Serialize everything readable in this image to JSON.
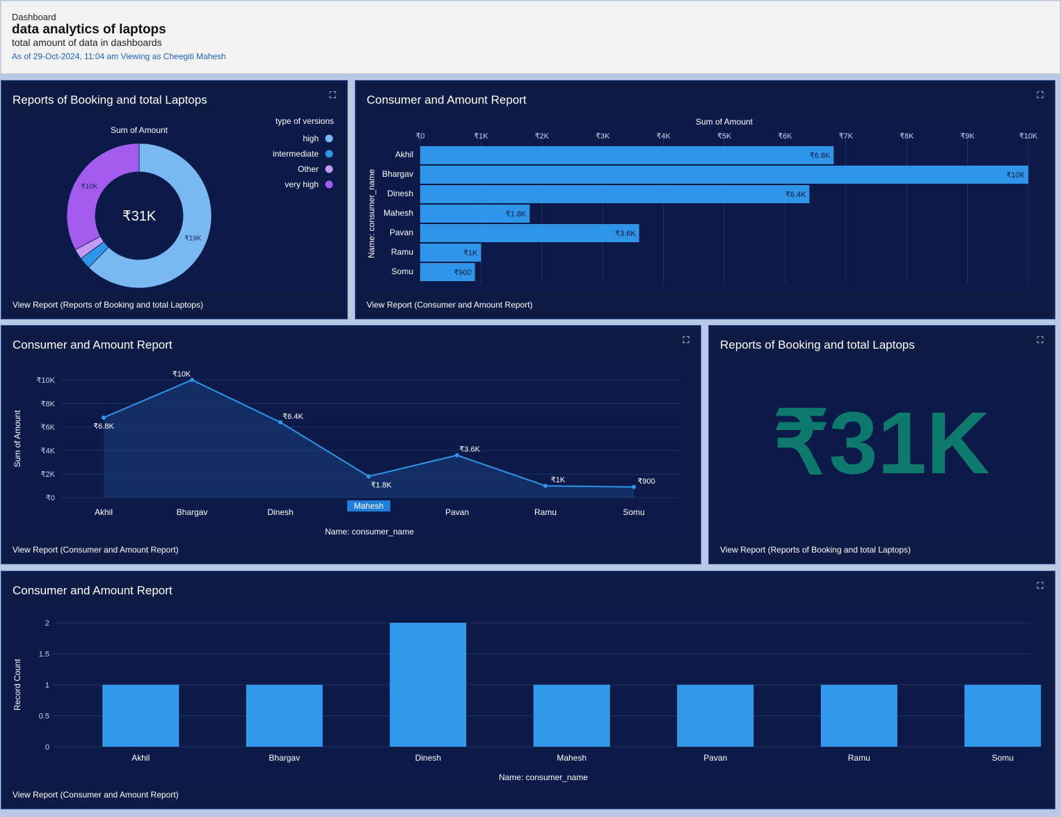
{
  "header": {
    "crumb": "Dashboard",
    "title": "data analytics of laptops",
    "subtitle": "total amount of data in dashboards",
    "meta": "As of 29-Oct-2024, 11:04 am Viewing as Cheegiti Mahesh"
  },
  "donut_card": {
    "title": "Reports of Booking and total Laptops",
    "view_report": "View Report (Reports of Booking and total Laptops)",
    "center_value": "₹31K"
  },
  "hbar_card": {
    "title": "Consumer and Amount Report",
    "view_report": "View Report (Consumer and Amount Report)"
  },
  "line_card": {
    "title": "Consumer and Amount Report",
    "view_report": "View Report (Consumer and Amount Report)"
  },
  "metric_card": {
    "title": "Reports of Booking and total Laptops",
    "value": "₹31K",
    "view_report": "View Report (Reports of Booking and total Laptops)"
  },
  "vbar_card": {
    "title": "Consumer and Amount Report",
    "view_report": "View Report (Consumer and Amount Report)"
  },
  "chart_data": [
    {
      "type": "pie",
      "title": "Sum of Amount",
      "legend_title": "type of versions",
      "legend_placement": "top-right",
      "slices": [
        {
          "name": "high",
          "value": 19000,
          "label": "₹19K",
          "color": "#7ab8f2"
        },
        {
          "name": "intermediate",
          "value": 800,
          "label": "",
          "color": "#2e95e8"
        },
        {
          "name": "Other",
          "value": 700,
          "label": "",
          "color": "#c49af5"
        },
        {
          "name": "very high",
          "value": 10000,
          "label": "₹10K",
          "color": "#a45cf0"
        }
      ]
    },
    {
      "type": "bar",
      "orientation": "horizontal",
      "title": "Sum of Amount",
      "ylabel": "Name: consumer_name",
      "categories": [
        "Akhil",
        "Bhargav",
        "Dinesh",
        "Mahesh",
        "Pavan",
        "Ramu",
        "Somu"
      ],
      "values": [
        6800,
        10000,
        6400,
        1800,
        3600,
        1000,
        900
      ],
      "labels": [
        "₹6.8K",
        "₹10K",
        "₹6.4K",
        "₹1.8K",
        "₹3.6K",
        "₹1K",
        "₹900"
      ],
      "xlim": [
        0,
        10000
      ],
      "ticks": [
        0,
        1000,
        2000,
        3000,
        4000,
        5000,
        6000,
        7000,
        8000,
        9000,
        10000
      ],
      "tick_labels": [
        "₹0",
        "₹1K",
        "₹2K",
        "₹3K",
        "₹4K",
        "₹5K",
        "₹6K",
        "₹7K",
        "₹8K",
        "₹9K",
        "₹10K"
      ],
      "grid": true,
      "color": "#2e95e8"
    },
    {
      "type": "line",
      "xlabel": "Name: consumer_name",
      "ylabel": "Sum of Amount",
      "categories": [
        "Akhil",
        "Bhargav",
        "Dinesh",
        "Mahesh",
        "Pavan",
        "Ramu",
        "Somu"
      ],
      "values": [
        6800,
        10000,
        6400,
        1800,
        3600,
        1000,
        900
      ],
      "labels": [
        "₹6.8K",
        "₹10K",
        "₹6.4K",
        "₹1.8K",
        "₹3.6K",
        "₹1K",
        "₹900"
      ],
      "ylim": [
        0,
        10000
      ],
      "ticks": [
        0,
        2000,
        4000,
        6000,
        8000,
        10000
      ],
      "tick_labels": [
        "₹0",
        "₹2K",
        "₹4K",
        "₹6K",
        "₹8K",
        "₹10K"
      ],
      "highlighted_category": "Mahesh",
      "grid": true,
      "color": "#2e95e8"
    },
    {
      "type": "bar",
      "orientation": "vertical",
      "xlabel": "Name: consumer_name",
      "ylabel": "Record Count",
      "categories": [
        "Akhil",
        "Bhargav",
        "Dinesh",
        "Mahesh",
        "Pavan",
        "Ramu",
        "Somu"
      ],
      "values": [
        1,
        1,
        2,
        1,
        1,
        1,
        1
      ],
      "ylim": [
        0,
        2
      ],
      "ticks": [
        0,
        0.5,
        1,
        1.5,
        2
      ],
      "tick_labels": [
        "0",
        "0.5",
        "1",
        "1.5",
        "2"
      ],
      "grid": true,
      "color": "#3399ea"
    }
  ]
}
